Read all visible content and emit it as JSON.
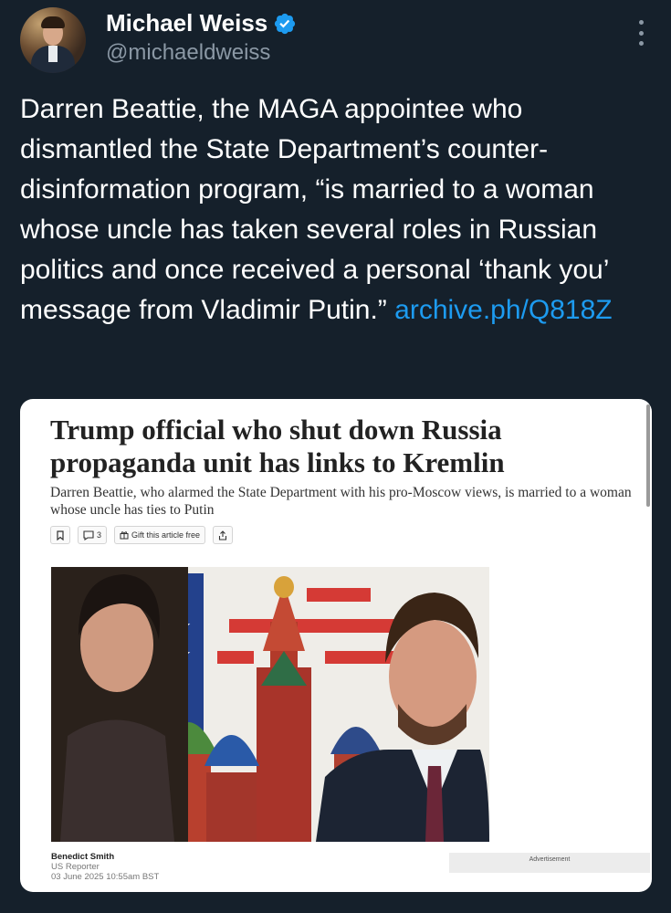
{
  "author": {
    "name": "Michael Weiss",
    "handle": "@michaeldweiss",
    "verified": true
  },
  "tweet": {
    "text": "Darren Beattie, the MAGA appointee who dismantled the State Department’s counter-disinformation program, “is married to a woman whose uncle has taken several roles in Russian politics and once received a personal ‘thank you’ message from Vladimir Putin.”",
    "link": "archive.ph/Q818Z"
  },
  "article": {
    "headline": "Trump official who shut down Russia propaganda unit has links to Kremlin",
    "subhead": "Darren Beattie, who alarmed the State Department with his pro-Moscow views, is married to a woman whose uncle has ties to Putin",
    "comment_count": "3",
    "gift_label": "Gift this article free",
    "byline": {
      "author": "Benedict Smith",
      "role": "US Reporter",
      "date": "03 June 2025 10:55am BST"
    },
    "ad_label": "Advertisement"
  },
  "icons": [
    "verified-badge-icon",
    "more-options-icon",
    "bookmark-icon",
    "comment-icon",
    "gift-icon",
    "share-icon"
  ],
  "colors": {
    "background": "#15202b",
    "text": "#ffffff",
    "secondary_text": "#8b98a5",
    "link": "#1d9bf0",
    "verified": "#1d9bf0"
  }
}
